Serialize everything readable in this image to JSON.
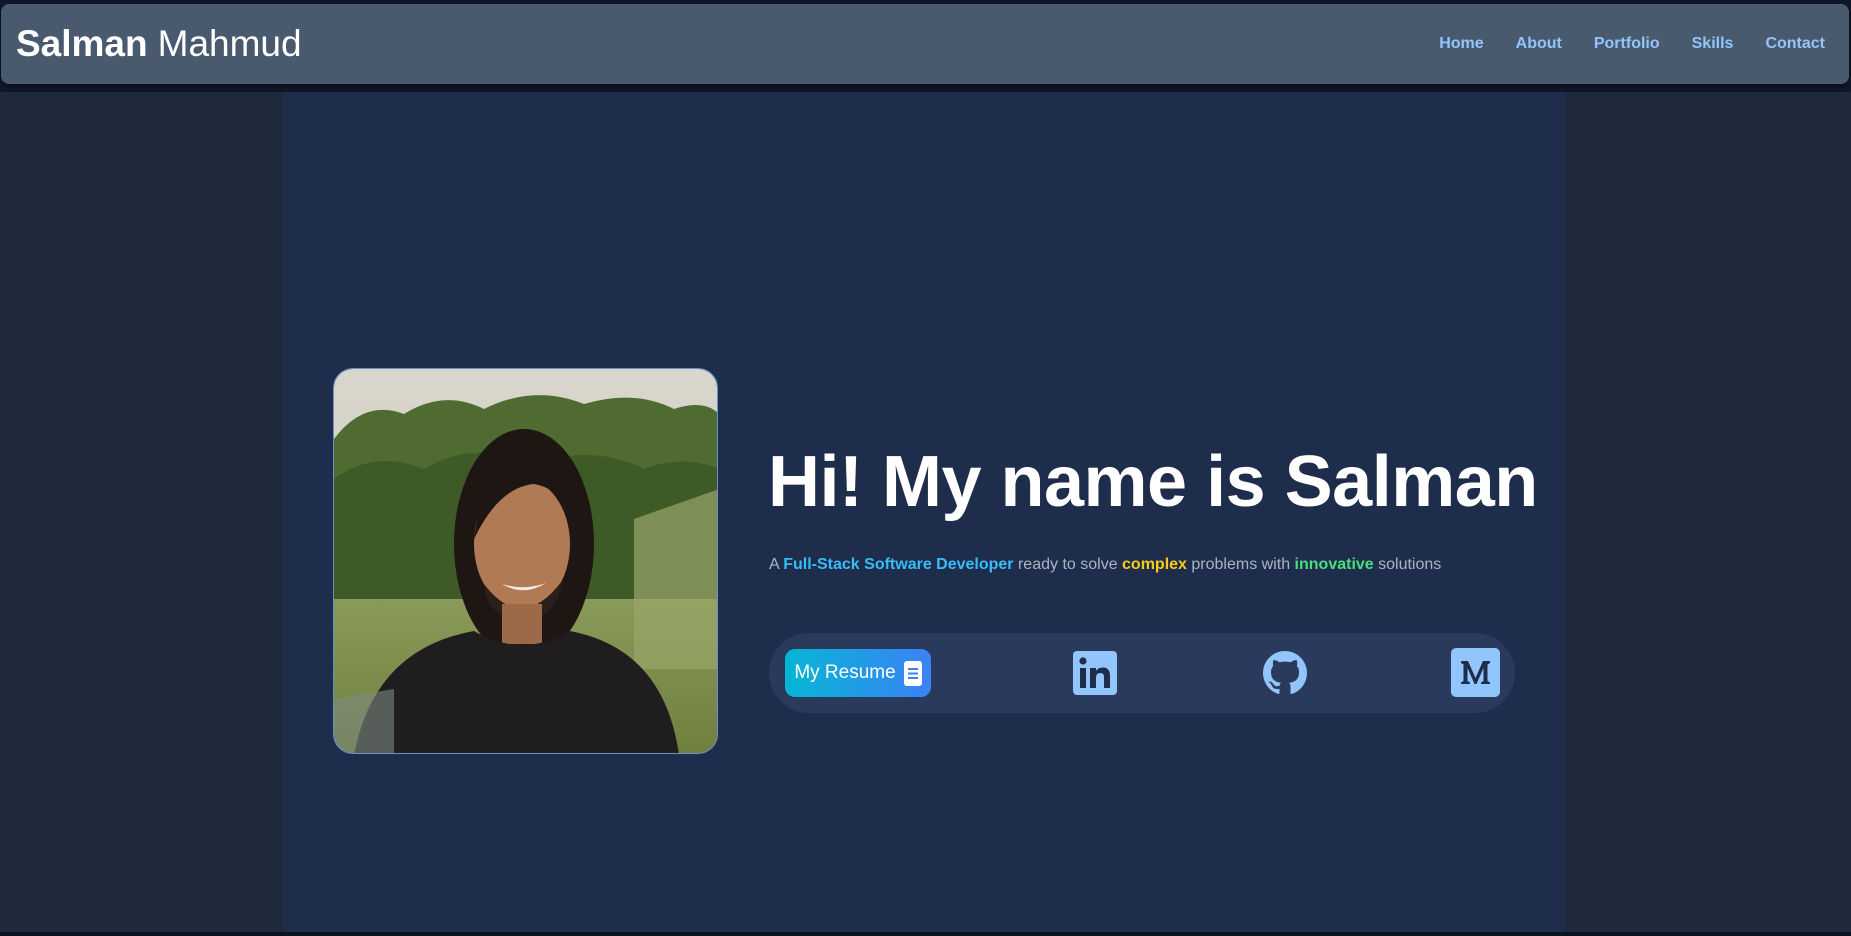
{
  "navbar": {
    "brand_first": "Salman",
    "brand_last": "Mahmud",
    "links": [
      "Home",
      "About",
      "Portfolio",
      "Skills",
      "Contact"
    ]
  },
  "hero": {
    "headline": "Hi! My name is Salman",
    "tagline": {
      "t1": "A ",
      "h1": "Full-Stack Software Developer",
      "t2": " ready to solve ",
      "h2": "complex",
      "t3": " problems with ",
      "h3": "innovative",
      "t4": " solutions"
    },
    "resume_label": "My Resume",
    "socials": {
      "linkedin": "linkedin-icon",
      "github": "github-icon",
      "medium": "medium-icon"
    }
  },
  "colors": {
    "nav_bg": "#4a5a6e",
    "nav_link": "#93c5fd",
    "container_bg": "#1e2d4b",
    "highlight_blue": "#38bdf8",
    "highlight_yellow": "#facc15",
    "highlight_green": "#4ade80",
    "icon_color": "#93c5fd"
  }
}
